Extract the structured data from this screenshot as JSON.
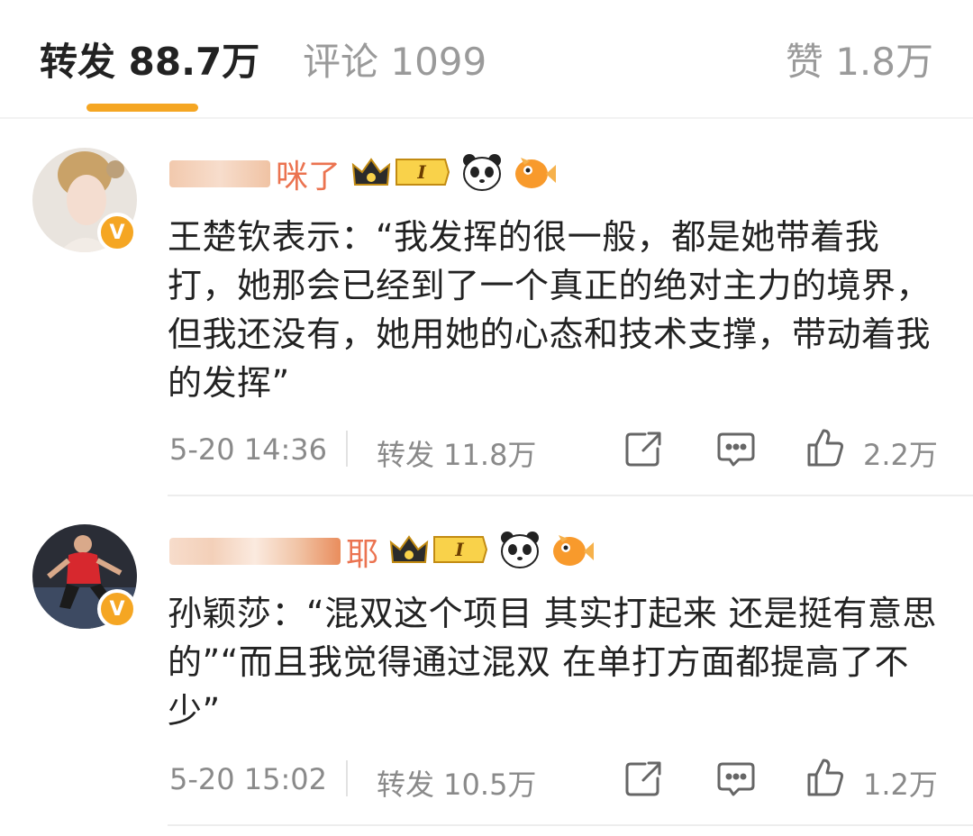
{
  "tabs": {
    "repost": "转发 88.7万",
    "comment": "评论 1099",
    "like": "赞 1.8万"
  },
  "items": [
    {
      "name_suffix": "咪了",
      "level": "I",
      "content": "王楚钦表示：“我发挥的很一般，都是她带着我打，她那会已经到了一个真正的绝对主力的境界，但我还没有，她用她的心态和技术支撑，带动着我的发挥”",
      "time": "5-20 14:36",
      "repost": "转发 11.8万",
      "likes": "2.2万",
      "verified": "V"
    },
    {
      "name_suffix": "耶",
      "level": "I",
      "content": "孙颖莎：“混双这个项目 其实打起来 还是挺有意思的”“而且我觉得通过混双 在单打方面都提高了不少”",
      "time": "5-20 15:02",
      "repost": "转发 10.5万",
      "likes": "1.2万",
      "verified": "V"
    }
  ],
  "icons": {
    "share": "share-icon",
    "comment": "comment-icon",
    "like": "thumbs-up-icon",
    "crown": "crown-icon",
    "panda": "panda-icon",
    "fish": "fish-icon"
  },
  "colors": {
    "accent": "#f5a623",
    "name": "#eb7350",
    "meta": "#8a8a8a"
  }
}
